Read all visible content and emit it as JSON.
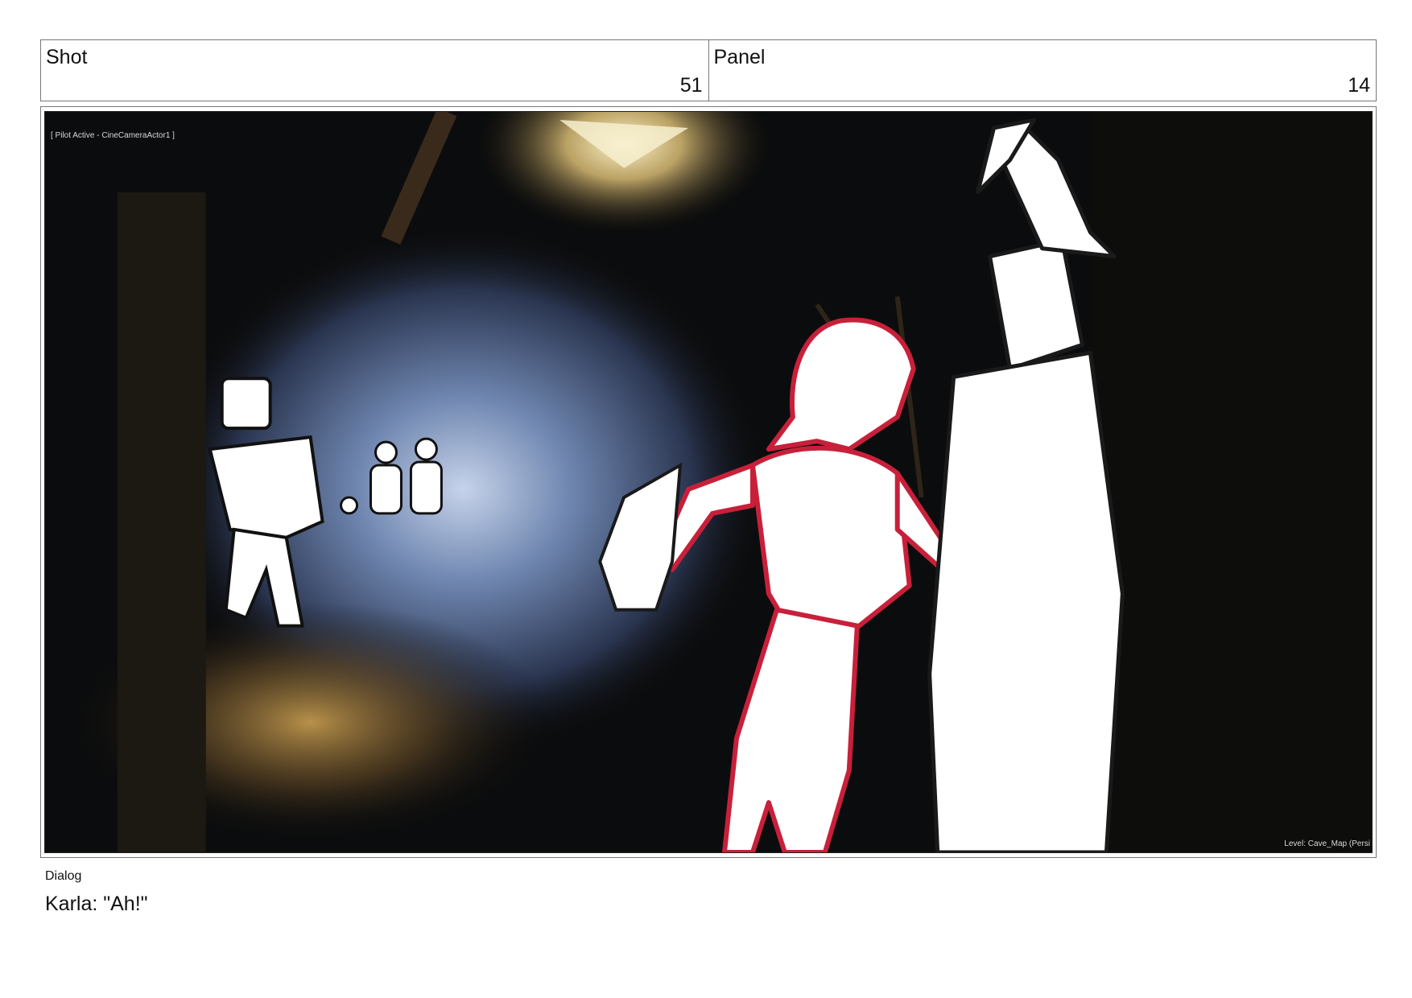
{
  "shot": {
    "label": "Shot",
    "value": "51"
  },
  "panel": {
    "label": "Panel",
    "value": "14"
  },
  "frame": {
    "overlay_pilot": "[ Pilot Active - CineCameraActor1 ]",
    "overlay_level": "Level:  Cave_Map (Persi"
  },
  "dialog": {
    "label": "Dialog",
    "text": "Karla: \"Ah!\""
  },
  "colors": {
    "sketch_red": "#c8203a",
    "sketch_white": "#ffffff",
    "cave_dark": "#0b0c0d",
    "cave_blue": "#6f86b0",
    "lamp_glow": "#f3e6b5"
  }
}
